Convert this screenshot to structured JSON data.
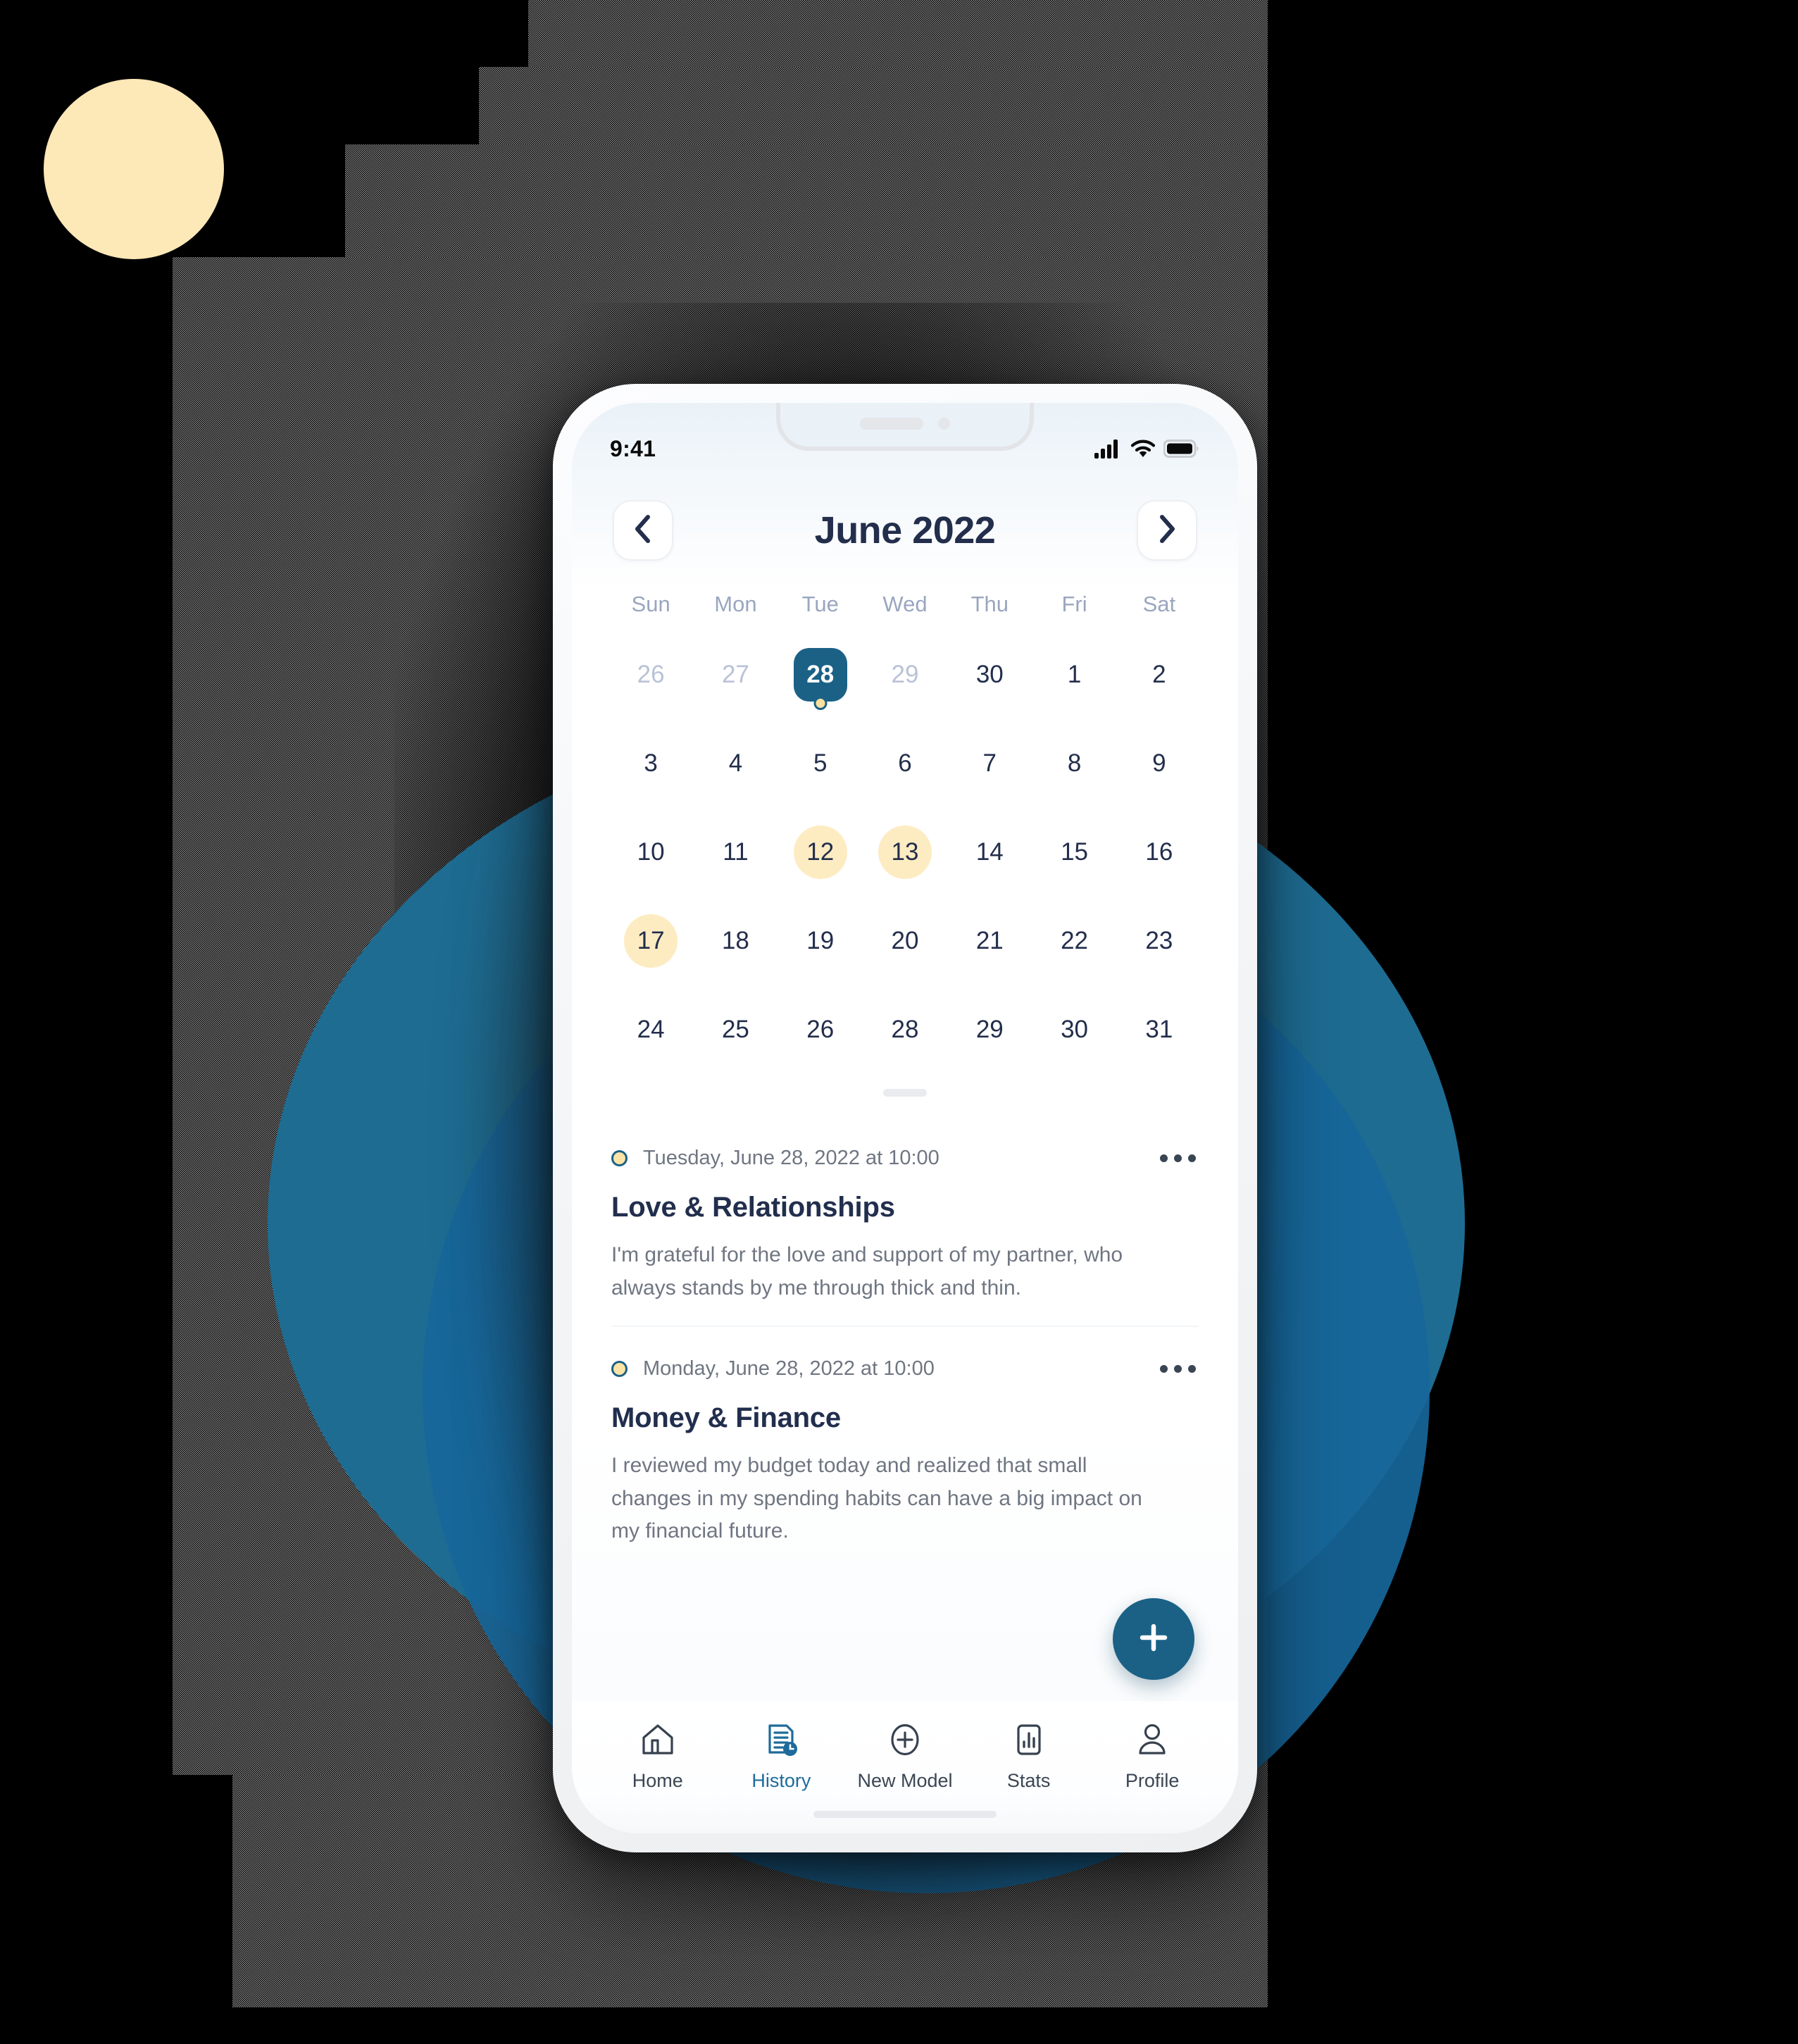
{
  "background": {
    "accent_yellow": "#FDE8B8",
    "accent_teal": "#1E6C92",
    "accent_teal_dark": "#17679B",
    "canvas": "#000000"
  },
  "status_bar": {
    "time": "9:41",
    "cellular_icon": "cellular-signal-icon",
    "wifi_icon": "wifi-icon",
    "battery_icon": "battery-icon"
  },
  "calendar": {
    "prev_icon": "chevron-left-icon",
    "next_icon": "chevron-right-icon",
    "month_title": "June 2022",
    "weekdays": [
      "Sun",
      "Mon",
      "Tue",
      "Wed",
      "Thu",
      "Fri",
      "Sat"
    ],
    "weeks": [
      [
        {
          "n": "26",
          "state": "muted"
        },
        {
          "n": "27",
          "state": "muted"
        },
        {
          "n": "28",
          "state": "selected",
          "dot": true
        },
        {
          "n": "29",
          "state": "muted"
        },
        {
          "n": "30",
          "state": "normal"
        },
        {
          "n": "1",
          "state": "normal"
        },
        {
          "n": "2",
          "state": "normal"
        }
      ],
      [
        {
          "n": "3",
          "state": "normal"
        },
        {
          "n": "4",
          "state": "normal"
        },
        {
          "n": "5",
          "state": "normal"
        },
        {
          "n": "6",
          "state": "normal"
        },
        {
          "n": "7",
          "state": "normal"
        },
        {
          "n": "8",
          "state": "normal"
        },
        {
          "n": "9",
          "state": "normal"
        }
      ],
      [
        {
          "n": "10",
          "state": "normal"
        },
        {
          "n": "11",
          "state": "normal"
        },
        {
          "n": "12",
          "state": "marked"
        },
        {
          "n": "13",
          "state": "marked"
        },
        {
          "n": "14",
          "state": "normal"
        },
        {
          "n": "15",
          "state": "normal"
        },
        {
          "n": "16",
          "state": "normal"
        }
      ],
      [
        {
          "n": "17",
          "state": "marked"
        },
        {
          "n": "18",
          "state": "normal"
        },
        {
          "n": "19",
          "state": "normal"
        },
        {
          "n": "20",
          "state": "normal"
        },
        {
          "n": "21",
          "state": "normal"
        },
        {
          "n": "22",
          "state": "normal"
        },
        {
          "n": "23",
          "state": "normal"
        }
      ],
      [
        {
          "n": "24",
          "state": "normal"
        },
        {
          "n": "25",
          "state": "normal"
        },
        {
          "n": "26",
          "state": "normal"
        },
        {
          "n": "28",
          "state": "normal"
        },
        {
          "n": "29",
          "state": "normal"
        },
        {
          "n": "30",
          "state": "normal"
        },
        {
          "n": "31",
          "state": "normal"
        }
      ]
    ],
    "selected_day": "28",
    "marked_days": [
      "12",
      "13",
      "17"
    ]
  },
  "entries": [
    {
      "date": "Tuesday, June 28, 2022 at 10:00",
      "title": "Love & Relationships",
      "body": "I'm grateful for the love and support of my partner, who always stands by me through thick and thin.",
      "more_icon": "more-horizontal-icon",
      "dot_icon": "entry-status-dot-icon"
    },
    {
      "date": "Monday, June 28, 2022 at 10:00",
      "title": "Money & Finance",
      "body": "I reviewed my budget today and realized that small changes in my spending habits can have a big impact on my financial future.",
      "more_icon": "more-horizontal-icon",
      "dot_icon": "entry-status-dot-icon"
    }
  ],
  "fab": {
    "icon": "plus-icon",
    "color": "#1B6186"
  },
  "bottom_nav": {
    "active": "History",
    "items": [
      {
        "label": "Home",
        "icon": "home-icon",
        "active": false
      },
      {
        "label": "History",
        "icon": "history-doc-clock-icon",
        "active": true
      },
      {
        "label": "New Model",
        "icon": "plus-circle-icon",
        "active": false
      },
      {
        "label": "Stats",
        "icon": "bar-chart-icon",
        "active": false
      },
      {
        "label": "Profile",
        "icon": "person-icon",
        "active": false
      }
    ]
  }
}
